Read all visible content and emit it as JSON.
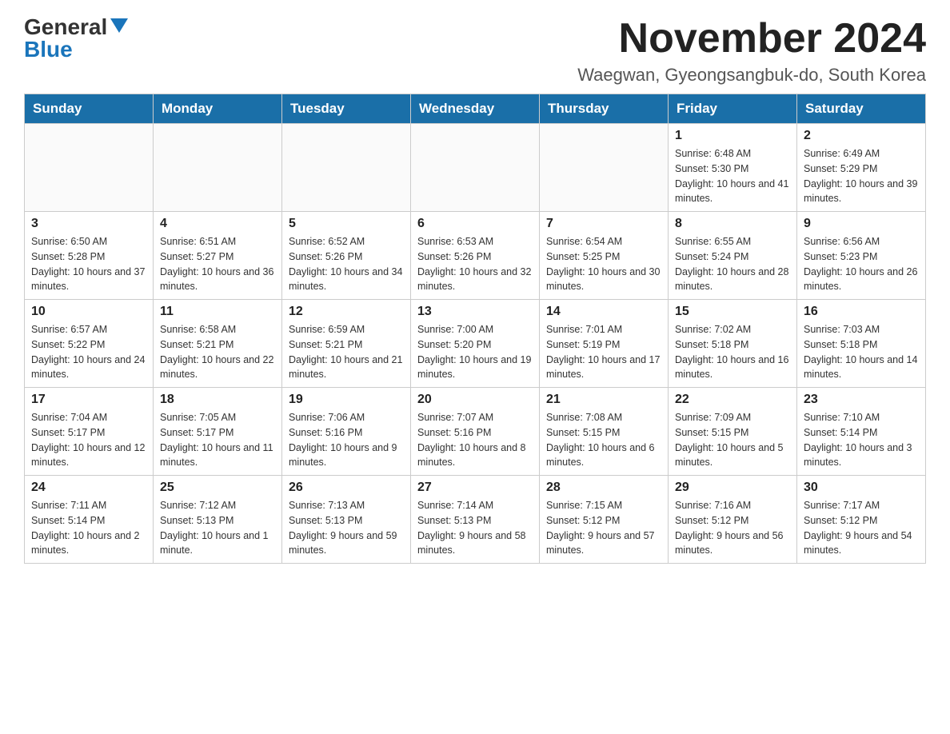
{
  "logo": {
    "general": "General",
    "blue": "Blue"
  },
  "header": {
    "month_year": "November 2024",
    "location": "Waegwan, Gyeongsangbuk-do, South Korea"
  },
  "weekdays": [
    "Sunday",
    "Monday",
    "Tuesday",
    "Wednesday",
    "Thursday",
    "Friday",
    "Saturday"
  ],
  "weeks": [
    [
      {
        "day": "",
        "info": ""
      },
      {
        "day": "",
        "info": ""
      },
      {
        "day": "",
        "info": ""
      },
      {
        "day": "",
        "info": ""
      },
      {
        "day": "",
        "info": ""
      },
      {
        "day": "1",
        "info": "Sunrise: 6:48 AM\nSunset: 5:30 PM\nDaylight: 10 hours and 41 minutes."
      },
      {
        "day": "2",
        "info": "Sunrise: 6:49 AM\nSunset: 5:29 PM\nDaylight: 10 hours and 39 minutes."
      }
    ],
    [
      {
        "day": "3",
        "info": "Sunrise: 6:50 AM\nSunset: 5:28 PM\nDaylight: 10 hours and 37 minutes."
      },
      {
        "day": "4",
        "info": "Sunrise: 6:51 AM\nSunset: 5:27 PM\nDaylight: 10 hours and 36 minutes."
      },
      {
        "day": "5",
        "info": "Sunrise: 6:52 AM\nSunset: 5:26 PM\nDaylight: 10 hours and 34 minutes."
      },
      {
        "day": "6",
        "info": "Sunrise: 6:53 AM\nSunset: 5:26 PM\nDaylight: 10 hours and 32 minutes."
      },
      {
        "day": "7",
        "info": "Sunrise: 6:54 AM\nSunset: 5:25 PM\nDaylight: 10 hours and 30 minutes."
      },
      {
        "day": "8",
        "info": "Sunrise: 6:55 AM\nSunset: 5:24 PM\nDaylight: 10 hours and 28 minutes."
      },
      {
        "day": "9",
        "info": "Sunrise: 6:56 AM\nSunset: 5:23 PM\nDaylight: 10 hours and 26 minutes."
      }
    ],
    [
      {
        "day": "10",
        "info": "Sunrise: 6:57 AM\nSunset: 5:22 PM\nDaylight: 10 hours and 24 minutes."
      },
      {
        "day": "11",
        "info": "Sunrise: 6:58 AM\nSunset: 5:21 PM\nDaylight: 10 hours and 22 minutes."
      },
      {
        "day": "12",
        "info": "Sunrise: 6:59 AM\nSunset: 5:21 PM\nDaylight: 10 hours and 21 minutes."
      },
      {
        "day": "13",
        "info": "Sunrise: 7:00 AM\nSunset: 5:20 PM\nDaylight: 10 hours and 19 minutes."
      },
      {
        "day": "14",
        "info": "Sunrise: 7:01 AM\nSunset: 5:19 PM\nDaylight: 10 hours and 17 minutes."
      },
      {
        "day": "15",
        "info": "Sunrise: 7:02 AM\nSunset: 5:18 PM\nDaylight: 10 hours and 16 minutes."
      },
      {
        "day": "16",
        "info": "Sunrise: 7:03 AM\nSunset: 5:18 PM\nDaylight: 10 hours and 14 minutes."
      }
    ],
    [
      {
        "day": "17",
        "info": "Sunrise: 7:04 AM\nSunset: 5:17 PM\nDaylight: 10 hours and 12 minutes."
      },
      {
        "day": "18",
        "info": "Sunrise: 7:05 AM\nSunset: 5:17 PM\nDaylight: 10 hours and 11 minutes."
      },
      {
        "day": "19",
        "info": "Sunrise: 7:06 AM\nSunset: 5:16 PM\nDaylight: 10 hours and 9 minutes."
      },
      {
        "day": "20",
        "info": "Sunrise: 7:07 AM\nSunset: 5:16 PM\nDaylight: 10 hours and 8 minutes."
      },
      {
        "day": "21",
        "info": "Sunrise: 7:08 AM\nSunset: 5:15 PM\nDaylight: 10 hours and 6 minutes."
      },
      {
        "day": "22",
        "info": "Sunrise: 7:09 AM\nSunset: 5:15 PM\nDaylight: 10 hours and 5 minutes."
      },
      {
        "day": "23",
        "info": "Sunrise: 7:10 AM\nSunset: 5:14 PM\nDaylight: 10 hours and 3 minutes."
      }
    ],
    [
      {
        "day": "24",
        "info": "Sunrise: 7:11 AM\nSunset: 5:14 PM\nDaylight: 10 hours and 2 minutes."
      },
      {
        "day": "25",
        "info": "Sunrise: 7:12 AM\nSunset: 5:13 PM\nDaylight: 10 hours and 1 minute."
      },
      {
        "day": "26",
        "info": "Sunrise: 7:13 AM\nSunset: 5:13 PM\nDaylight: 9 hours and 59 minutes."
      },
      {
        "day": "27",
        "info": "Sunrise: 7:14 AM\nSunset: 5:13 PM\nDaylight: 9 hours and 58 minutes."
      },
      {
        "day": "28",
        "info": "Sunrise: 7:15 AM\nSunset: 5:12 PM\nDaylight: 9 hours and 57 minutes."
      },
      {
        "day": "29",
        "info": "Sunrise: 7:16 AM\nSunset: 5:12 PM\nDaylight: 9 hours and 56 minutes."
      },
      {
        "day": "30",
        "info": "Sunrise: 7:17 AM\nSunset: 5:12 PM\nDaylight: 9 hours and 54 minutes."
      }
    ]
  ]
}
